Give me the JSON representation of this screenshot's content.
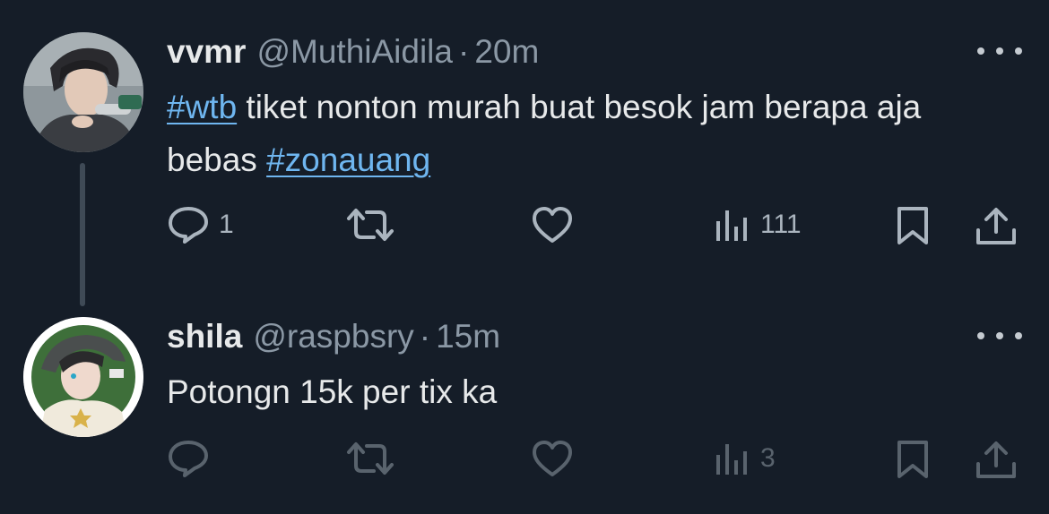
{
  "tweets": [
    {
      "display_name": "vvmr",
      "handle": "@MuthiAidila",
      "separator": "·",
      "time": "20m",
      "text_segments": [
        {
          "text": "#wtb",
          "hashtag": true
        },
        {
          "text": " tiket nonton murah buat besok jam berapa aja bebas ",
          "hashtag": false
        },
        {
          "text": "#zonauang",
          "hashtag": true
        }
      ],
      "reply_count": "1",
      "retweet_count": "",
      "like_count": "",
      "views_count": "111",
      "avatar_icon": "avatar-photo"
    },
    {
      "display_name": "shila",
      "handle": "@raspbsry",
      "separator": "·",
      "time": "15m",
      "text_segments": [
        {
          "text": "Potongn 15k per tix ka",
          "hashtag": false
        }
      ],
      "reply_count": "",
      "retweet_count": "",
      "like_count": "",
      "views_count": "3",
      "avatar_icon": "avatar-photo"
    }
  ],
  "icons": {
    "reply": "comment-bubble-icon",
    "retweet": "retweet-arrows-icon",
    "like": "heart-icon",
    "views": "bar-chart-icon",
    "bookmark": "bookmark-icon",
    "share": "share-upload-icon",
    "more": "three-dots-icon"
  },
  "colors": {
    "background": "#151d28",
    "text": "#e7e9ea",
    "secondary": "#8b98a5",
    "hashtag": "#6fb6f0"
  }
}
